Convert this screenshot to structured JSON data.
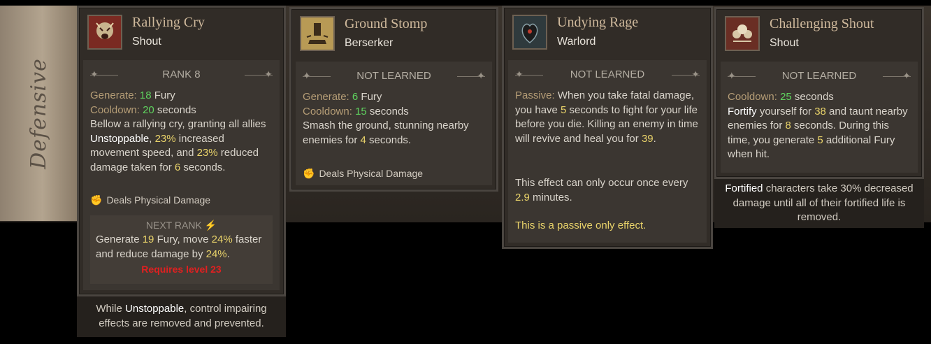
{
  "section": {
    "label": "Defensive"
  },
  "cards": [
    {
      "title": "Rallying Cry",
      "type": "Shout",
      "status": "RANK 8",
      "generate_label": "Generate:",
      "generate_value": "18",
      "generate_unit": "Fury",
      "cooldown_label": "Cooldown:",
      "cooldown_value": "20",
      "cooldown_unit": "seconds",
      "desc_a": "Bellow a rallying cry, granting all allies ",
      "desc_b": "Unstoppable",
      "desc_c": ", ",
      "desc_d": "23%",
      "desc_e": " increased movement speed, and ",
      "desc_f": "23%",
      "desc_g": " reduced damage taken for ",
      "desc_h": "6",
      "desc_i": " seconds.",
      "damage": "Deals Physical Damage",
      "next_rank_label": "NEXT RANK",
      "next_a": "Generate ",
      "next_b": "19",
      "next_c": " Fury, move ",
      "next_d": "24%",
      "next_e": " faster and reduce damage by ",
      "next_f": "24%",
      "next_g": ".",
      "requires": "Requires level 23",
      "footer_a": "While ",
      "footer_b": "Unstoppable",
      "footer_c": ", control impairing effects are removed and prevented."
    },
    {
      "title": "Ground Stomp",
      "type": "Berserker",
      "status": "NOT LEARNED",
      "generate_label": "Generate:",
      "generate_value": "6",
      "generate_unit": "Fury",
      "cooldown_label": "Cooldown:",
      "cooldown_value": "15",
      "cooldown_unit": "seconds",
      "desc_a": "Smash the ground, stunning nearby enemies for ",
      "desc_b": "4",
      "desc_c": " seconds.",
      "damage": "Deals Physical Damage"
    },
    {
      "title": "Undying Rage",
      "type": "Warlord",
      "status": "NOT LEARNED",
      "passive_label": "Passive:",
      "desc_a": " When you take fatal damage, you have ",
      "desc_b": "5",
      "desc_c": " seconds to fight for your life before you die. Killing an enemy in time will revive and heal you for ",
      "desc_d": "39",
      "desc_e": ".",
      "desc2_a": "This effect can only occur once every ",
      "desc2_b": "2.9",
      "desc2_c": " minutes.",
      "passive_note": "This is a passive only effect."
    },
    {
      "title": "Challenging Shout",
      "type": "Shout",
      "status": "NOT LEARNED",
      "cooldown_label": "Cooldown:",
      "cooldown_value": "25",
      "cooldown_unit": "seconds",
      "desc_a": "Fortify",
      "desc_b": " yourself for ",
      "desc_c": "38",
      "desc_d": " and taunt nearby enemies for ",
      "desc_e": "8",
      "desc_f": " seconds. During this time, you generate ",
      "desc_g": "5",
      "desc_h": " additional Fury when hit.",
      "footer_a": "Fortified",
      "footer_b": " characters take 30% decreased damage until all of their fortified life is removed."
    }
  ]
}
